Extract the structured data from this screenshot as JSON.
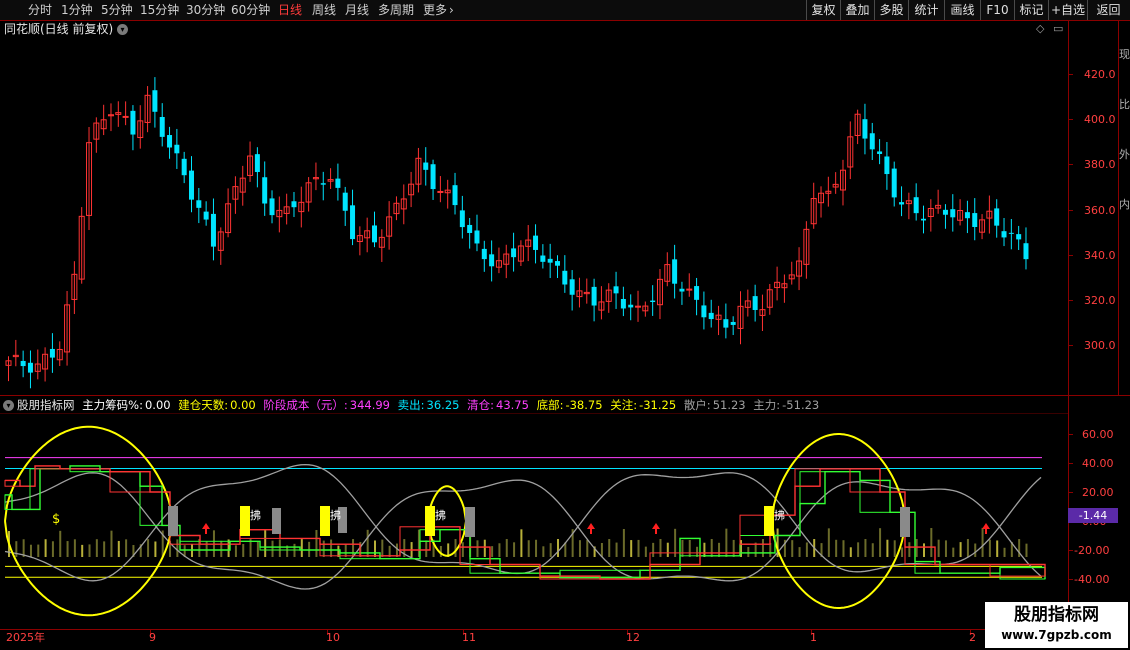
{
  "toolbar": {
    "periods": [
      "分时",
      "1分钟",
      "5分钟",
      "15分钟",
      "30分钟",
      "60分钟",
      "日线",
      "周线",
      "月线",
      "多周期",
      "更多"
    ],
    "active_period": "日线",
    "more_arrow": "›",
    "tools": [
      "复权",
      "叠加",
      "多股",
      "统计",
      "画线",
      "F10",
      "标记",
      "+自选",
      "返回"
    ]
  },
  "main_chart": {
    "title": "同花顺(日线 前复权)",
    "y_ticks": [
      "420.0",
      "400.0",
      "380.0",
      "360.0",
      "340.0",
      "320.0",
      "300.0"
    ],
    "side_label": "现\n比\n外\n内"
  },
  "indicator": {
    "name": "股朋指标网",
    "fields": [
      {
        "label": "主力筹码%:",
        "value": "0.00",
        "color": "#ffffff"
      },
      {
        "label": "建仓天数:",
        "value": "0.00",
        "color": "#ffff00"
      },
      {
        "label": "阶段成本（元）:",
        "value": "344.99",
        "color": "#ff40ff"
      },
      {
        "label": "卖出:",
        "value": "36.25",
        "color": "#00e5ff"
      },
      {
        "label": "清仓:",
        "value": "43.75",
        "color": "#ff40ff"
      },
      {
        "label": "底部:",
        "value": "-38.75",
        "color": "#ffff00"
      },
      {
        "label": "关注:",
        "value": "-31.25",
        "color": "#ffff00"
      },
      {
        "label": "散户:",
        "value": "51.23",
        "color": "#a0a0a0"
      },
      {
        "label": "主力:",
        "value": "-51.23",
        "color": "#a0a0a0"
      }
    ],
    "y_ticks": [
      "60.00",
      "40.00",
      "20.00",
      "0.00",
      "-20.00",
      "-40.00"
    ],
    "current_value": "-1.44",
    "dollar_mark": "$",
    "buy_mark": "拂"
  },
  "time_axis": {
    "labels": [
      "2025年",
      "9",
      "10",
      "11",
      "12",
      "1",
      "2"
    ]
  },
  "watermark": {
    "line1": "股朋指标网",
    "line2": "www.7gpzb.com"
  },
  "colors": {
    "up": "#ff3333",
    "down": "#00e5ff",
    "axis": "#8b0000",
    "yellow": "#ffff00",
    "magenta": "#ff40ff",
    "cyan_line": "#00e5ff",
    "gray_line": "#a0a0a0"
  }
}
